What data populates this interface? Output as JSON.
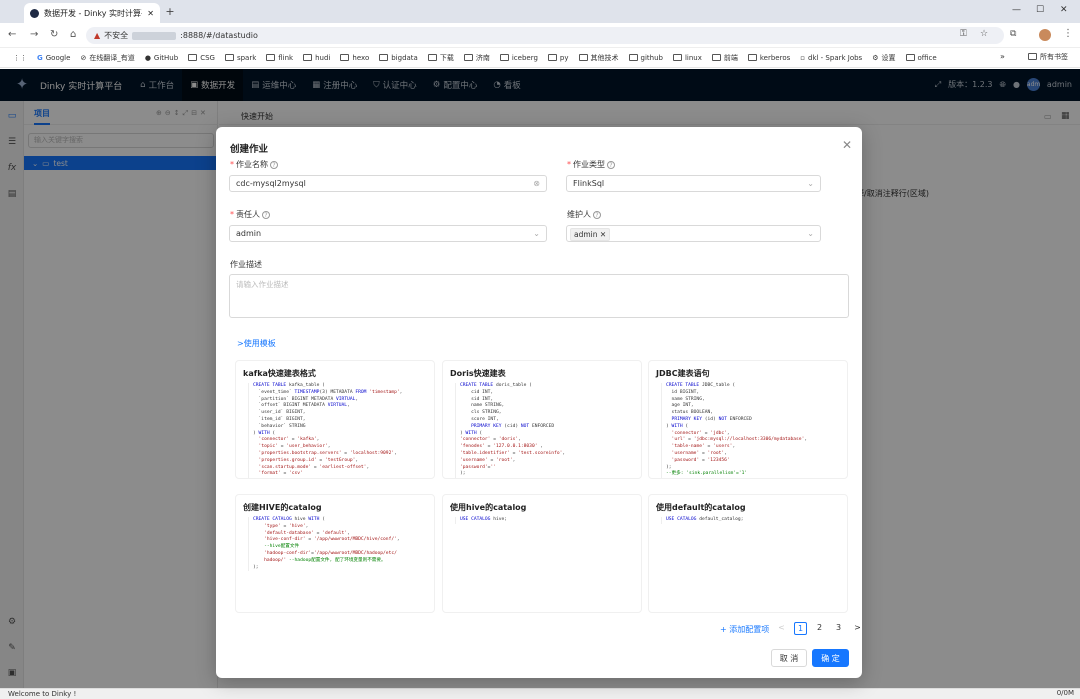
{
  "browser": {
    "tab_title": "数据开发 - Dinky 实时计算平台",
    "new_tab": "+",
    "insecure_label": "不安全",
    "url": ":8888/#/datastudio",
    "bookmarks": [
      "Google",
      "在线翻译_有道",
      "GitHub",
      "CSG",
      "spark",
      "flink",
      "hudi",
      "hexo",
      "bigdata",
      "下载",
      "济南",
      "iceberg",
      "py",
      "其他技术",
      "github",
      "linux",
      "前端",
      "kerberos",
      "dkl - Spark Jobs",
      "设置",
      "office"
    ],
    "all_bookmarks": "所有书签",
    "more": "»"
  },
  "app": {
    "brand": "Dinky 实时计算平台",
    "menu": [
      "工作台",
      "数据开发",
      "运维中心",
      "注册中心",
      "认证中心",
      "配置中心",
      "看板"
    ],
    "version": "版本：1.2.3",
    "user": "admin",
    "avatar_text": "adm"
  },
  "project": {
    "tab": "项目",
    "search_placeholder": "输入关键字搜索",
    "tree_item": "test"
  },
  "main": {
    "tab": "快速开始",
    "hint": "注释/取消注释行(区域)"
  },
  "status": {
    "left": "Welcome to Dinky !",
    "right": "0/0M"
  },
  "modal": {
    "title": "创建作业",
    "job_name_label": "作业名称",
    "job_name_value": "cdc-mysql2mysql",
    "job_type_label": "作业类型",
    "job_type_value": "FlinkSql",
    "owner_label": "责任人",
    "owner_value": "admin",
    "maintainer_label": "维护人",
    "maintainer_tag": "admin",
    "desc_label": "作业描述",
    "desc_placeholder": "请输入作业描述",
    "use_template": ">使用模板",
    "add_config": "+ 添加配置项",
    "pages": [
      "1",
      "2",
      "3"
    ],
    "prev": "<",
    "next": ">",
    "cancel": "取 消",
    "ok": "确 定",
    "templates": [
      {
        "title": "kafka快速建表格式"
      },
      {
        "title": "Doris快速建表"
      },
      {
        "title": "JDBC建表语句"
      },
      {
        "title": "创建HIVE的catalog"
      },
      {
        "title": "使用hive的catalog"
      },
      {
        "title": "使用default的catalog"
      }
    ]
  }
}
